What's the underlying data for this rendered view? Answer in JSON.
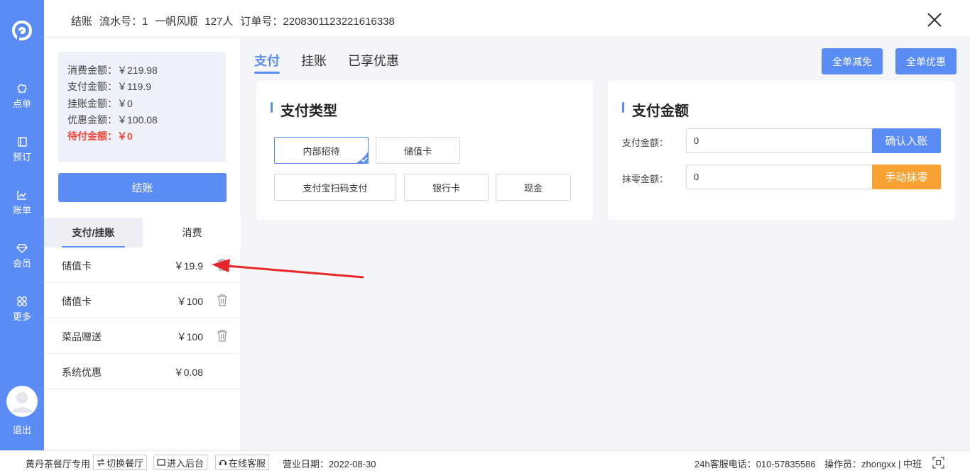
{
  "nav": {
    "items": [
      {
        "label": "点单",
        "icon": "chef-hat-icon"
      },
      {
        "label": "预订",
        "icon": "book-icon"
      },
      {
        "label": "账单",
        "icon": "chart-icon"
      },
      {
        "label": "会员",
        "icon": "diamond-icon"
      },
      {
        "label": "更多",
        "icon": "grid-icon"
      }
    ],
    "logout": "退出"
  },
  "header": {
    "title": "结账",
    "serial": "流水号：1",
    "table": "一帆风顺",
    "guests": "127人",
    "order_no": "订单号：2208301123221616338"
  },
  "summary": {
    "consume": "消费金额：￥219.98",
    "paid": "支付金额：￥119.9",
    "credit": "挂账金额：￥0",
    "discount": "优惠金额：￥100.08",
    "due": "待付金额：￥0"
  },
  "checkout_label": "结账",
  "left_tabs": [
    "支付/挂账",
    "消费"
  ],
  "payments": [
    {
      "name": "储值卡",
      "amount": "￥19.9",
      "deletable": true
    },
    {
      "name": "储值卡",
      "amount": "￥100",
      "deletable": true
    },
    {
      "name": "菜品赠送",
      "amount": "￥100",
      "deletable": true
    },
    {
      "name": "系统优惠",
      "amount": "￥0.08",
      "deletable": false
    }
  ],
  "main_tabs": [
    "支付",
    "挂账",
    "已享优惠"
  ],
  "header_buttons": {
    "waive": "全单减免",
    "discount": "全单优惠"
  },
  "pay_type": {
    "title": "支付类型",
    "options": [
      "内部招待",
      "储值卡",
      "支付宝扫码支付",
      "银行卡",
      "现金"
    ],
    "selected": "内部招待"
  },
  "pay_amount": {
    "title": "支付金额",
    "amount_label": "支付金额：",
    "amount_value": "0",
    "confirm": "确认入账",
    "round_label": "抹零金额：",
    "round_value": "0",
    "round_btn": "手动抹零"
  },
  "footer": {
    "store": "黄丹茶餐厅专用",
    "switch": "切换餐厅",
    "backend": "进入后台",
    "service": "在线客服",
    "biz_date": "营业日期：2022-08-30",
    "hotline": "24h客服电话：010-57835586",
    "operator": "操作员：zhongxx | 中班"
  },
  "colors": {
    "primary": "#5b8cf6",
    "warning": "#f8a234",
    "danger": "#f04a3b",
    "annotation": "#e8262a"
  }
}
